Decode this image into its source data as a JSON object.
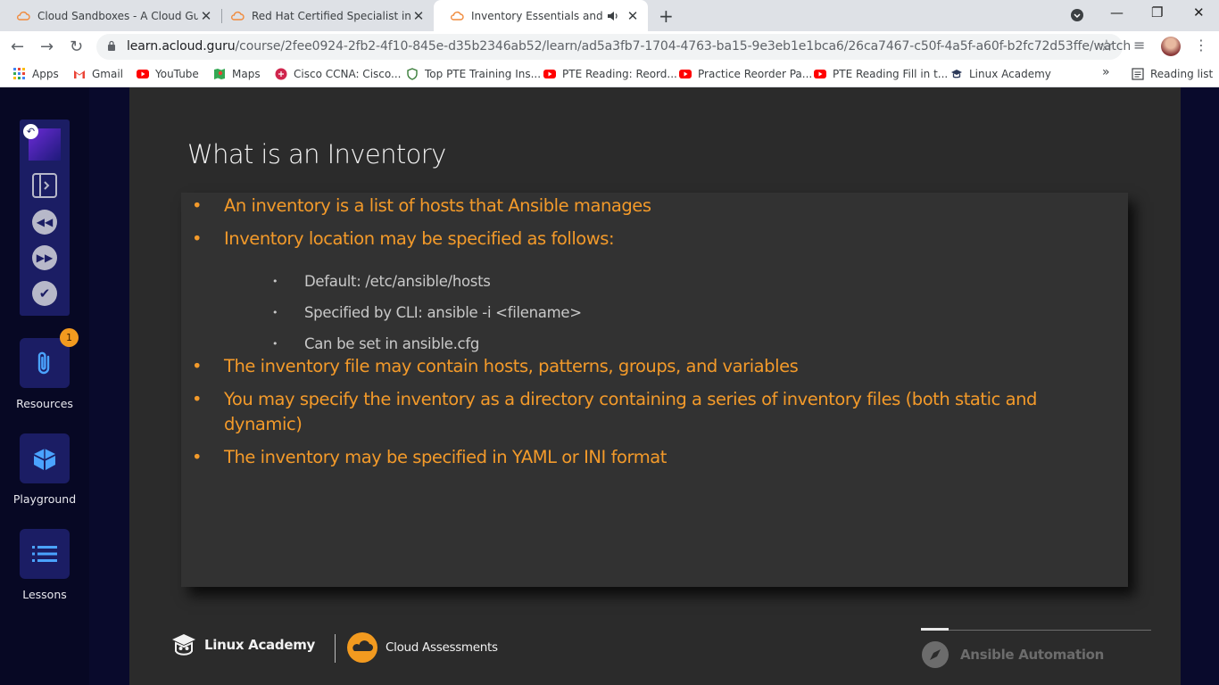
{
  "browser": {
    "tabs": [
      {
        "title": "Cloud Sandboxes - A Cloud Guru",
        "close": "✕"
      },
      {
        "title": "Red Hat Certified Specialist in An",
        "close": "✕"
      },
      {
        "title": "Inventory Essentials and Inve",
        "close": "✕"
      }
    ],
    "new_tab": "+",
    "url_domain": "learn.acloud.guru",
    "url_path": "/course/2fee0924-2fb2-4f10-845e-d35b2346ab52/learn/ad5a3fb7-1704-4763-ba15-9e3eb1e1bca6/26ca7467-c50f-4a5f-a60f-b2fc72d53ffe/watch",
    "bookmarks": [
      "Apps",
      "Gmail",
      "YouTube",
      "Maps",
      "Cisco CCNA: Cisco...",
      "Top PTE Training Ins...",
      "PTE Reading: Reord...",
      "Practice Reorder Pa...",
      "PTE Reading Fill in t...",
      "Linux Academy"
    ],
    "bookmarks_more": "»",
    "reading_list": "Reading list"
  },
  "sidebar": {
    "resources_label": "Resources",
    "resources_badge": "1",
    "playground_label": "Playground",
    "lessons_label": "Lessons"
  },
  "slide": {
    "title": "What is an Inventory",
    "bullets": [
      "An inventory is a list of hosts that Ansible manages",
      "Inventory location may be specified as follows:",
      "The inventory file may contain hosts, patterns, groups, and variables",
      "You may specify the inventory as a directory containing a series of inventory files (both static and dynamic)",
      "The inventory may be specified in YAML or INI format"
    ],
    "sub_bullets": [
      "Default: /etc/ansible/hosts",
      "Specified by CLI: ansible -i <filename>",
      "Can be set in ansible.cfg"
    ],
    "bullet_char": "•",
    "footer_left": "Linux Academy",
    "footer_middle": "Cloud Assessments",
    "footer_right": "Ansible Automation",
    "colors": {
      "bullet_text": "#f39a2a",
      "sub_text": "#c9c9c9",
      "slide_bg": "#2b2b2b"
    }
  }
}
